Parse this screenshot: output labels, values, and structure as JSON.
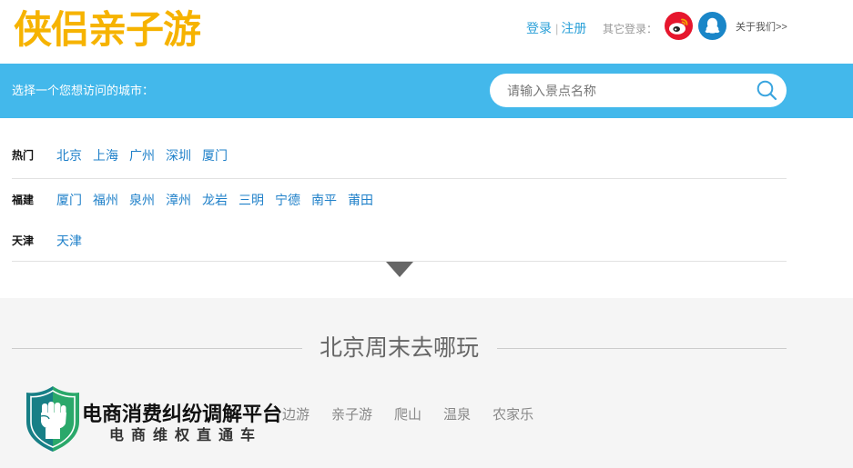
{
  "header": {
    "logo_text": "侠侣亲子游",
    "login_label": "登录",
    "separator": "|",
    "register_label": "注册",
    "other_login_label": "其它登录：",
    "weibo_icon": "weibo-icon",
    "qq_icon": "qq-icon",
    "about_label": "关于我们>>"
  },
  "city_bar": {
    "prompt": "选择一个您想访问的城市：",
    "search_placeholder": "请输入景点名称",
    "search_icon": "search-icon"
  },
  "city_groups": [
    {
      "label": "热门",
      "cities": [
        "北京",
        "上海",
        "广州",
        "深圳",
        "厦门"
      ]
    },
    {
      "label": "福建",
      "cities": [
        "厦门",
        "福州",
        "泉州",
        "漳州",
        "龙岩",
        "三明",
        "宁德",
        "南平",
        "莆田"
      ]
    },
    {
      "label": "天津",
      "cities": [
        "天津"
      ]
    }
  ],
  "expand_icon": "caret-down-icon",
  "weekend": {
    "title": "北京周末去哪玩",
    "tabs": [
      "边游",
      "亲子游",
      "爬山",
      "温泉",
      "农家乐"
    ]
  },
  "watermark": {
    "icon": "shield-fist-icon",
    "title": "电商消费纠纷调解平台",
    "subtitle": "电商维权直通车"
  },
  "colors": {
    "logo": "#f6b300",
    "city_bar": "#43b8eb",
    "link": "#1f80c9",
    "auth_link": "#2aa0d8",
    "section_bg": "#f5f5f5",
    "weibo": "#e6162d",
    "qq": "#1a86c8"
  }
}
